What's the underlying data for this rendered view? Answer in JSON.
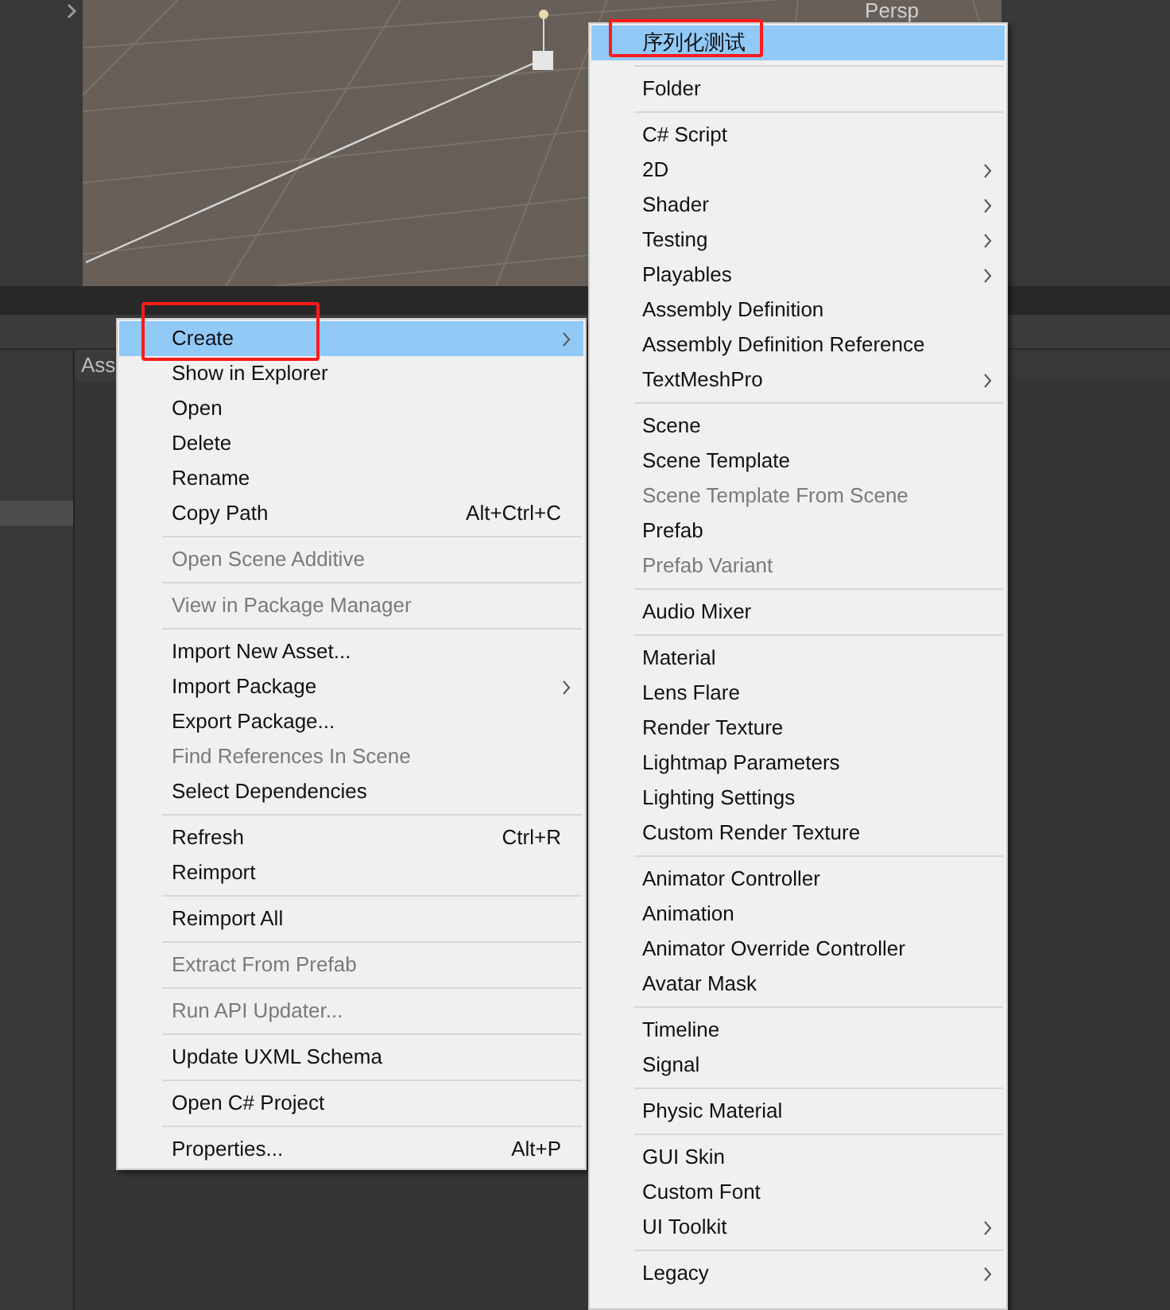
{
  "scene_view": {
    "camera_label": "Persp"
  },
  "project_panel": {
    "tab_label": "Ass"
  },
  "context_menu": {
    "groups": [
      [
        {
          "label": "Create",
          "submenu": true,
          "selected": true,
          "annotated": true,
          "disabled": false
        },
        {
          "label": "Show in Explorer",
          "submenu": false,
          "selected": false,
          "annotated": false,
          "disabled": false
        },
        {
          "label": "Open",
          "submenu": false,
          "selected": false,
          "annotated": false,
          "disabled": false
        },
        {
          "label": "Delete",
          "submenu": false,
          "selected": false,
          "annotated": false,
          "disabled": false
        },
        {
          "label": "Rename",
          "submenu": false,
          "selected": false,
          "annotated": false,
          "disabled": false
        },
        {
          "label": "Copy Path",
          "shortcut": "Alt+Ctrl+C",
          "submenu": false,
          "selected": false,
          "annotated": false,
          "disabled": false
        }
      ],
      [
        {
          "label": "Open Scene Additive",
          "submenu": false,
          "selected": false,
          "annotated": false,
          "disabled": true
        }
      ],
      [
        {
          "label": "View in Package Manager",
          "submenu": false,
          "selected": false,
          "annotated": false,
          "disabled": true
        }
      ],
      [
        {
          "label": "Import New Asset...",
          "submenu": false,
          "selected": false,
          "annotated": false,
          "disabled": false
        },
        {
          "label": "Import Package",
          "submenu": true,
          "selected": false,
          "annotated": false,
          "disabled": false
        },
        {
          "label": "Export Package...",
          "submenu": false,
          "selected": false,
          "annotated": false,
          "disabled": false
        },
        {
          "label": "Find References In Scene",
          "submenu": false,
          "selected": false,
          "annotated": false,
          "disabled": true
        },
        {
          "label": "Select Dependencies",
          "submenu": false,
          "selected": false,
          "annotated": false,
          "disabled": false
        }
      ],
      [
        {
          "label": "Refresh",
          "shortcut": "Ctrl+R",
          "submenu": false,
          "selected": false,
          "annotated": false,
          "disabled": false
        },
        {
          "label": "Reimport",
          "submenu": false,
          "selected": false,
          "annotated": false,
          "disabled": false
        }
      ],
      [
        {
          "label": "Reimport All",
          "submenu": false,
          "selected": false,
          "annotated": false,
          "disabled": false
        }
      ],
      [
        {
          "label": "Extract From Prefab",
          "submenu": false,
          "selected": false,
          "annotated": false,
          "disabled": true
        }
      ],
      [
        {
          "label": "Run API Updater...",
          "submenu": false,
          "selected": false,
          "annotated": false,
          "disabled": true
        }
      ],
      [
        {
          "label": "Update UXML Schema",
          "submenu": false,
          "selected": false,
          "annotated": false,
          "disabled": false
        }
      ],
      [
        {
          "label": "Open C# Project",
          "submenu": false,
          "selected": false,
          "annotated": false,
          "disabled": false
        }
      ],
      [
        {
          "label": "Properties...",
          "shortcut": "Alt+P",
          "submenu": false,
          "selected": false,
          "annotated": false,
          "disabled": false
        }
      ]
    ]
  },
  "create_submenu": {
    "groups": [
      [
        {
          "label": "序列化测试",
          "submenu": false,
          "selected": true,
          "annotated": true,
          "disabled": false
        }
      ],
      [
        {
          "label": "Folder",
          "submenu": false,
          "selected": false,
          "annotated": false,
          "disabled": false
        }
      ],
      [
        {
          "label": "C# Script",
          "submenu": false,
          "selected": false,
          "annotated": false,
          "disabled": false
        },
        {
          "label": "2D",
          "submenu": true,
          "selected": false,
          "annotated": false,
          "disabled": false
        },
        {
          "label": "Shader",
          "submenu": true,
          "selected": false,
          "annotated": false,
          "disabled": false
        },
        {
          "label": "Testing",
          "submenu": true,
          "selected": false,
          "annotated": false,
          "disabled": false
        },
        {
          "label": "Playables",
          "submenu": true,
          "selected": false,
          "annotated": false,
          "disabled": false
        },
        {
          "label": "Assembly Definition",
          "submenu": false,
          "selected": false,
          "annotated": false,
          "disabled": false
        },
        {
          "label": "Assembly Definition Reference",
          "submenu": false,
          "selected": false,
          "annotated": false,
          "disabled": false
        },
        {
          "label": "TextMeshPro",
          "submenu": true,
          "selected": false,
          "annotated": false,
          "disabled": false
        }
      ],
      [
        {
          "label": "Scene",
          "submenu": false,
          "selected": false,
          "annotated": false,
          "disabled": false
        },
        {
          "label": "Scene Template",
          "submenu": false,
          "selected": false,
          "annotated": false,
          "disabled": false
        },
        {
          "label": "Scene Template From Scene",
          "submenu": false,
          "selected": false,
          "annotated": false,
          "disabled": true
        },
        {
          "label": "Prefab",
          "submenu": false,
          "selected": false,
          "annotated": false,
          "disabled": false
        },
        {
          "label": "Prefab Variant",
          "submenu": false,
          "selected": false,
          "annotated": false,
          "disabled": true
        }
      ],
      [
        {
          "label": "Audio Mixer",
          "submenu": false,
          "selected": false,
          "annotated": false,
          "disabled": false
        }
      ],
      [
        {
          "label": "Material",
          "submenu": false,
          "selected": false,
          "annotated": false,
          "disabled": false
        },
        {
          "label": "Lens Flare",
          "submenu": false,
          "selected": false,
          "annotated": false,
          "disabled": false
        },
        {
          "label": "Render Texture",
          "submenu": false,
          "selected": false,
          "annotated": false,
          "disabled": false
        },
        {
          "label": "Lightmap Parameters",
          "submenu": false,
          "selected": false,
          "annotated": false,
          "disabled": false
        },
        {
          "label": "Lighting Settings",
          "submenu": false,
          "selected": false,
          "annotated": false,
          "disabled": false
        },
        {
          "label": "Custom Render Texture",
          "submenu": false,
          "selected": false,
          "annotated": false,
          "disabled": false
        }
      ],
      [
        {
          "label": "Animator Controller",
          "submenu": false,
          "selected": false,
          "annotated": false,
          "disabled": false
        },
        {
          "label": "Animation",
          "submenu": false,
          "selected": false,
          "annotated": false,
          "disabled": false
        },
        {
          "label": "Animator Override Controller",
          "submenu": false,
          "selected": false,
          "annotated": false,
          "disabled": false
        },
        {
          "label": "Avatar Mask",
          "submenu": false,
          "selected": false,
          "annotated": false,
          "disabled": false
        }
      ],
      [
        {
          "label": "Timeline",
          "submenu": false,
          "selected": false,
          "annotated": false,
          "disabled": false
        },
        {
          "label": "Signal",
          "submenu": false,
          "selected": false,
          "annotated": false,
          "disabled": false
        }
      ],
      [
        {
          "label": "Physic Material",
          "submenu": false,
          "selected": false,
          "annotated": false,
          "disabled": false
        }
      ],
      [
        {
          "label": "GUI Skin",
          "submenu": false,
          "selected": false,
          "annotated": false,
          "disabled": false
        },
        {
          "label": "Custom Font",
          "submenu": false,
          "selected": false,
          "annotated": false,
          "disabled": false
        },
        {
          "label": "UI Toolkit",
          "submenu": true,
          "selected": false,
          "annotated": false,
          "disabled": false
        }
      ],
      [
        {
          "label": "Legacy",
          "submenu": true,
          "selected": false,
          "annotated": false,
          "disabled": false
        }
      ]
    ]
  }
}
